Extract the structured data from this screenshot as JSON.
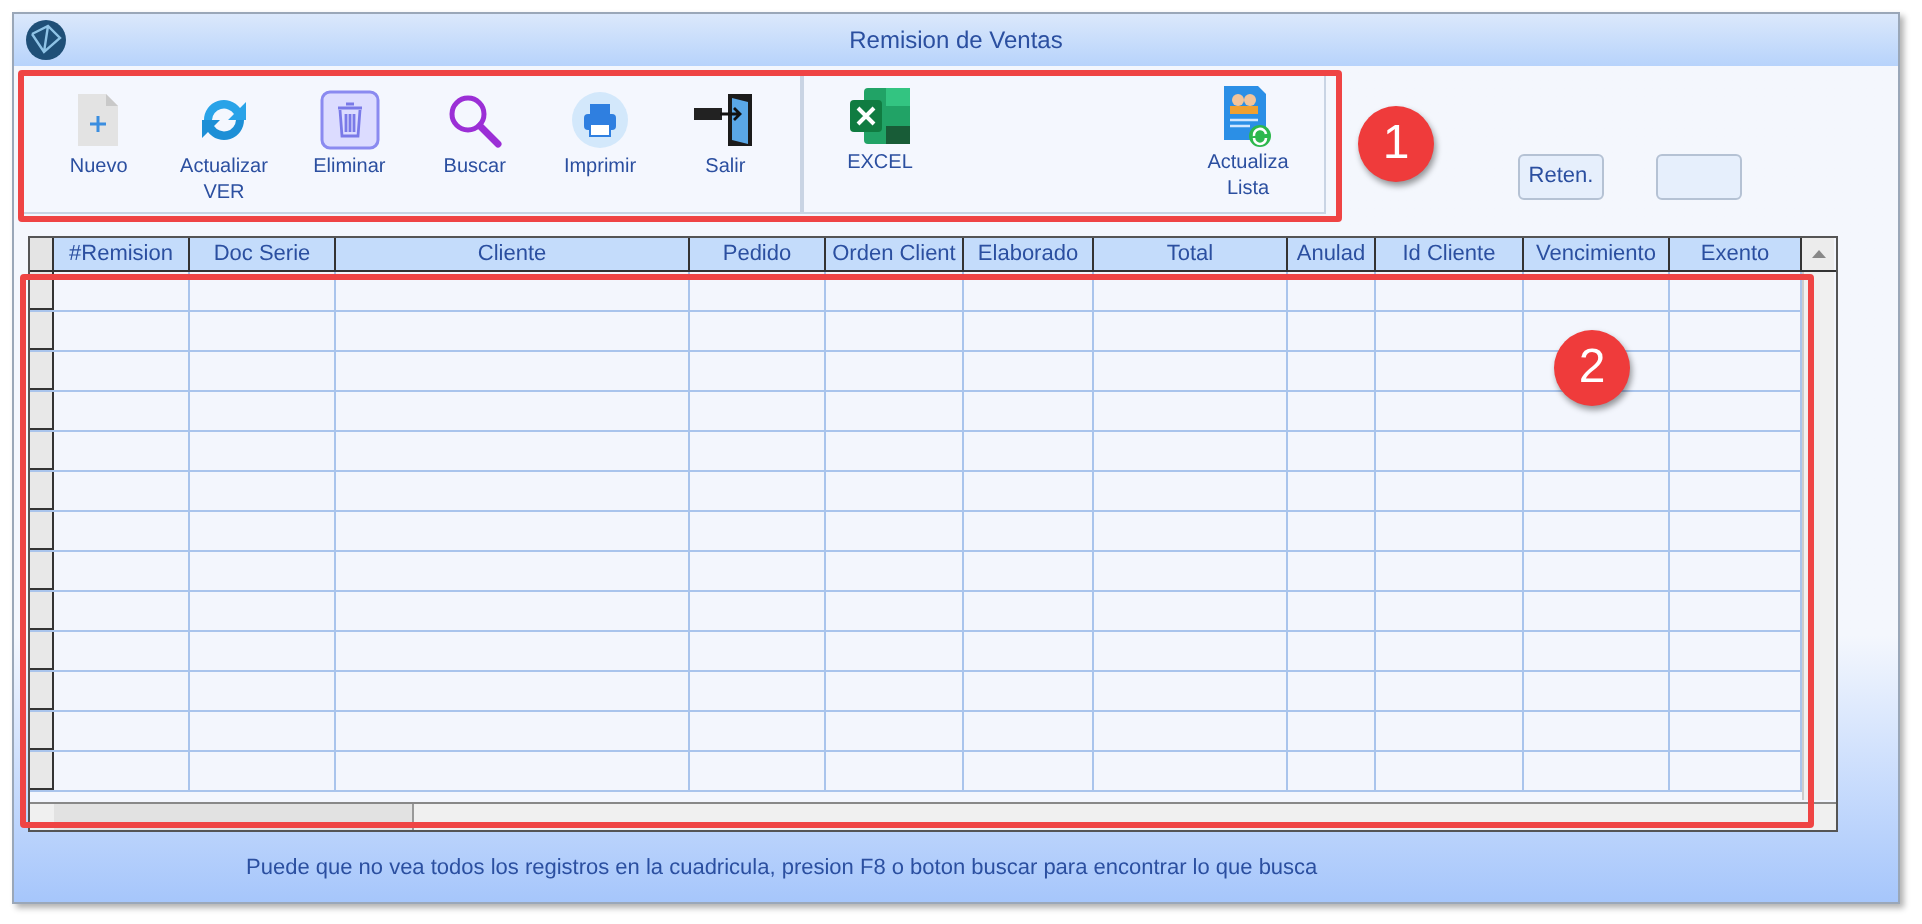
{
  "window": {
    "title": "Remision de Ventas"
  },
  "toolbar": {
    "groups": [
      {
        "buttons": [
          {
            "label": "Nuevo",
            "kind": "new"
          },
          {
            "label": "Actualizar VER",
            "kind": "refresh"
          },
          {
            "label": "Eliminar",
            "kind": "delete"
          },
          {
            "label": "Buscar",
            "kind": "search"
          },
          {
            "label": "Imprimir",
            "kind": "print"
          },
          {
            "label": "Salir",
            "kind": "exit"
          }
        ]
      },
      {
        "buttons": [
          {
            "label": "EXCEL",
            "kind": "excel"
          },
          {
            "label": "Actualiza Lista",
            "kind": "list"
          }
        ]
      }
    ]
  },
  "side_buttons": [
    {
      "label": "Reten.",
      "kind": "text"
    },
    {
      "kind": "blank"
    }
  ],
  "table": {
    "columns": [
      "#Remision",
      "Doc Serie",
      "Cliente",
      "Pedido",
      "Orden Client",
      "Elaborado",
      "Total",
      "Anulad",
      "Id Cliente",
      "Vencimiento",
      "Exento"
    ]
  },
  "hint": "Puede que no vea todos los registros en la cuadricula, presion F8 o boton buscar para encontrar lo que busca",
  "annotations": [
    {
      "label": "1"
    },
    {
      "label": "2"
    }
  ]
}
